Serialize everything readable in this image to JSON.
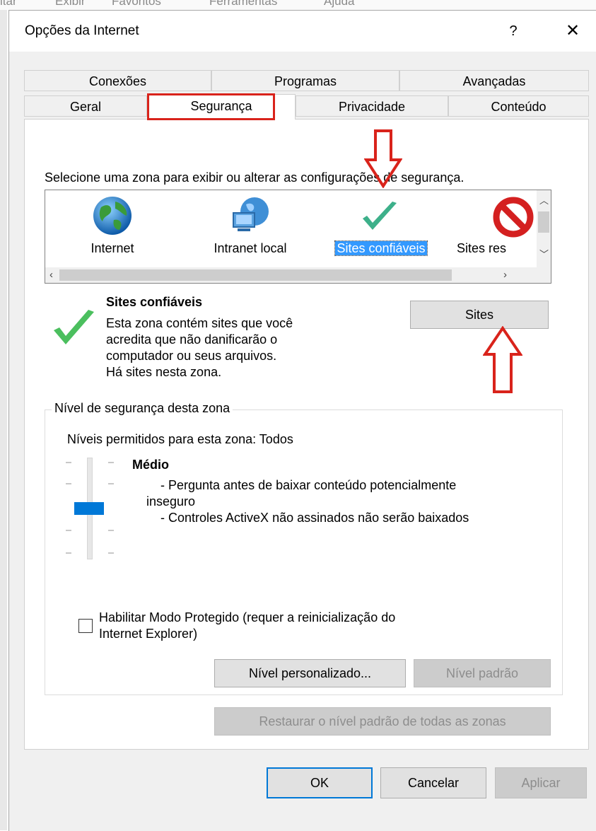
{
  "background_app": {
    "menu_items": [
      "itar",
      "Exibir",
      "Favoritos",
      "Ferramentas",
      "Ajuda"
    ]
  },
  "dialog": {
    "title": "Opções da Internet",
    "help_label": "?",
    "close_label": "✕"
  },
  "tabs": {
    "row1": [
      "Conexões",
      "Programas",
      "Avançadas"
    ],
    "row2": [
      "Geral",
      "Segurança",
      "Privacidade",
      "Conteúdo"
    ],
    "active": "Segurança"
  },
  "security": {
    "instruction": "Selecione uma zona para exibir ou alterar as configurações de segurança.",
    "zones": [
      {
        "label": "Internet",
        "icon": "globe-icon"
      },
      {
        "label": "Intranet local",
        "icon": "intranet-icon"
      },
      {
        "label": "Sites confiáveis",
        "icon": "checkmark-icon",
        "selected": true
      },
      {
        "label": "Sites res",
        "icon": "restricted-icon"
      }
    ],
    "selected_zone_name": "Sites confiáveis",
    "selected_zone_description": [
      "Esta zona contém sites que você",
      "acredita que não danificarão o",
      "computador ou seus arquivos.",
      "Há sites nesta zona."
    ],
    "sites_button": "Sites",
    "level_group_title": "Nível de segurança desta zona",
    "allowed_levels": "Níveis permitidos para esta zona: Todos",
    "slider_level_fraction": 0.5,
    "level_name": "Médio",
    "level_details": [
      "- Pergunta antes de baixar conteúdo potencialmente",
      "inseguro",
      "- Controles ActiveX não assinados não serão baixados"
    ],
    "protected_mode_label": [
      "Habilitar Modo Protegido (requer a reinicialização do",
      "Internet Explorer)"
    ],
    "protected_mode_checked": false,
    "custom_level_button": "Nível personalizado...",
    "default_level_button": "Nível padrão",
    "reset_all_button": "Restaurar o nível padrão de todas as zonas"
  },
  "footer": {
    "ok": "OK",
    "cancel": "Cancelar",
    "apply": "Aplicar"
  },
  "colors": {
    "annotation_red": "#d9231b",
    "selection_blue": "#3399ff",
    "slider_blue": "#0078d7",
    "check_green": "#3cb371"
  }
}
